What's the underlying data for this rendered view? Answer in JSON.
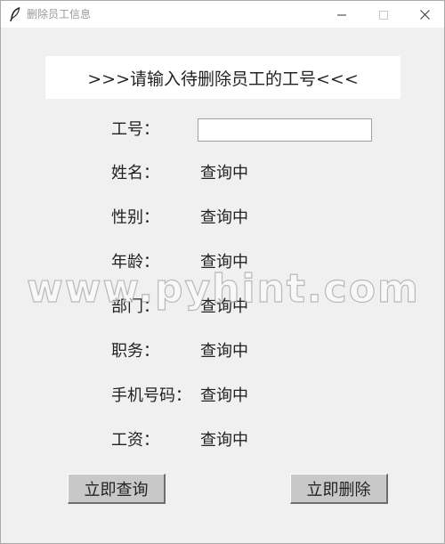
{
  "window": {
    "title": "删除员工信息",
    "icon": "feather-icon",
    "controls": [
      "minimize-icon",
      "maximize-icon",
      "close-icon"
    ]
  },
  "header": {
    "text": ">>>请输入待删除员工的工号<<<"
  },
  "form": {
    "id_label": "工号：",
    "id_value": "",
    "fields": [
      {
        "label": "姓名：",
        "value": "查询中"
      },
      {
        "label": "性别：",
        "value": "查询中"
      },
      {
        "label": "年龄：",
        "value": "查询中"
      },
      {
        "label": "部门：",
        "value": "查询中"
      },
      {
        "label": "职务：",
        "value": "查询中"
      },
      {
        "label": "手机号码：",
        "value": "查询中"
      },
      {
        "label": "工资：",
        "value": "查询中"
      }
    ]
  },
  "buttons": {
    "query_label": "立即查询",
    "delete_label": "立即删除"
  },
  "watermark": {
    "text": "www.pyhint.com"
  }
}
